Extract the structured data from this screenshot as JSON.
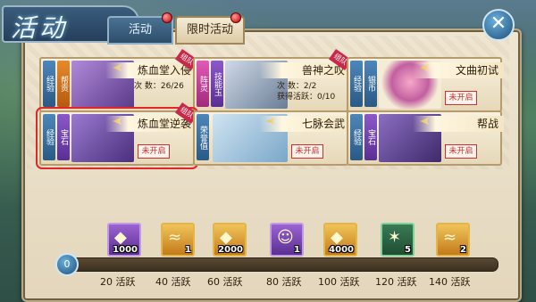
{
  "header": {
    "title": "活动",
    "tabs": [
      {
        "label": "活动",
        "active": false
      },
      {
        "label": "限时活动",
        "active": true
      }
    ],
    "close_icon": "close-icon"
  },
  "cards": [
    {
      "name": "炼血堂入侵",
      "tags": [
        "经验",
        "帮贡"
      ],
      "info": [
        "次 数：26/26"
      ],
      "group": "组队",
      "status": "",
      "selected": false
    },
    {
      "name": "兽神之叹",
      "tags": [
        "阵灵",
        "技能玉"
      ],
      "info": [
        "次 数：2/2",
        "获得活跃：0/10"
      ],
      "group": "组队",
      "status": "",
      "selected": false
    },
    {
      "name": "文曲初试",
      "tags": [
        "经验",
        "银币"
      ],
      "info": [],
      "group": "",
      "status": "未开启",
      "selected": false
    },
    {
      "name": "炼血堂逆袭",
      "tags": [
        "经验",
        "宝石"
      ],
      "info": [],
      "group": "组队",
      "status": "未开启",
      "selected": true
    },
    {
      "name": "七脉会武",
      "tags": [
        "荣誉值"
      ],
      "info": [],
      "group": "",
      "status": "未开启",
      "selected": false
    },
    {
      "name": "帮战",
      "tags": [
        "经验",
        "宝石"
      ],
      "info": [],
      "group": "",
      "status": "未开启",
      "selected": false
    }
  ],
  "progress": {
    "current": "0"
  },
  "rewards": [
    {
      "qty": "1000",
      "icon": "gold-ingot-icon",
      "style": "rw-purple",
      "milestone": "20 活跃"
    },
    {
      "qty": "1",
      "icon": "scroll-icon",
      "style": "rw-gold",
      "milestone": "40 活跃"
    },
    {
      "qty": "2000",
      "icon": "gold-ingot-icon",
      "style": "rw-gold",
      "milestone": "60 活跃"
    },
    {
      "qty": "1",
      "icon": "character-portrait-icon",
      "style": "rw-purple",
      "milestone": "80 活跃"
    },
    {
      "qty": "4000",
      "icon": "gold-ingot-icon",
      "style": "rw-gold",
      "milestone": "100 活跃"
    },
    {
      "qty": "5",
      "icon": "claw-item-icon",
      "style": "rw-green",
      "milestone": "120 活跃"
    },
    {
      "qty": "2",
      "icon": "scroll-icon",
      "style": "rw-gold",
      "milestone": "140 活跃"
    }
  ]
}
